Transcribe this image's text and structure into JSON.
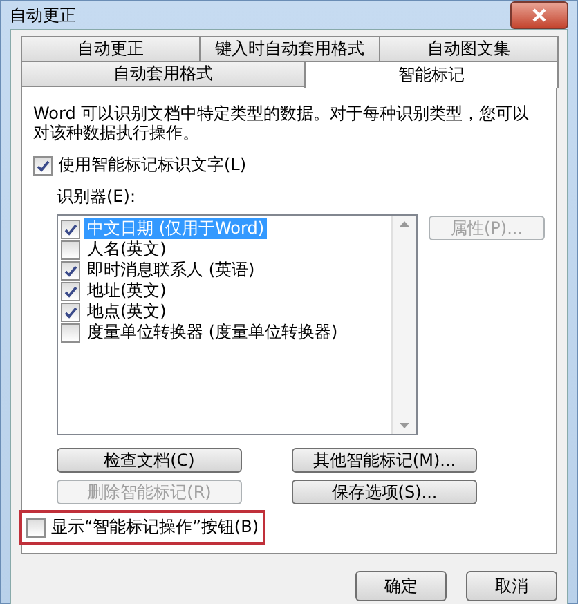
{
  "window": {
    "title": "自动更正"
  },
  "tab_rows": [
    {
      "tabs": [
        {
          "label": "自动更正",
          "selected": false
        },
        {
          "label": "键入时自动套用格式",
          "selected": false
        },
        {
          "label": "自动图文集",
          "selected": false
        }
      ]
    },
    {
      "tabs": [
        {
          "label": "自动套用格式",
          "selected": false
        },
        {
          "label": "智能标记",
          "selected": true
        }
      ]
    }
  ],
  "description": "Word 可以识别文档中特定类型的数据。对于每种识别类型，您可以对该种数据执行操作。",
  "label_text_checkbox": {
    "label": "使用智能标记标识文字(L)",
    "checked": true
  },
  "recognizers": {
    "label": "识别器(E):",
    "items": [
      {
        "label": "中文日期 (仅用于Word)",
        "checked": true,
        "selected": true
      },
      {
        "label": "人名(英文)",
        "checked": false,
        "selected": false
      },
      {
        "label": "即时消息联系人 (英语)",
        "checked": true,
        "selected": false
      },
      {
        "label": "地址(英文)",
        "checked": true,
        "selected": false
      },
      {
        "label": "地点(英文)",
        "checked": true,
        "selected": false
      },
      {
        "label": "度量单位转换器 (度量单位转换器)",
        "checked": false,
        "selected": false
      }
    ]
  },
  "properties_button": {
    "label": "属性(P)...",
    "disabled": true
  },
  "action_buttons": [
    {
      "label": "检查文档(C)",
      "disabled": false
    },
    {
      "label": "其他智能标记(M)...",
      "disabled": false
    },
    {
      "label": "删除智能标记(R)",
      "disabled": true
    },
    {
      "label": "保存选项(S)...",
      "disabled": false
    }
  ],
  "show_actions_checkbox": {
    "label": "显示“智能标记操作”按钮(B)",
    "checked": false,
    "highlighted": true
  },
  "footer_buttons": [
    {
      "label": "确定"
    },
    {
      "label": "取消"
    }
  ]
}
